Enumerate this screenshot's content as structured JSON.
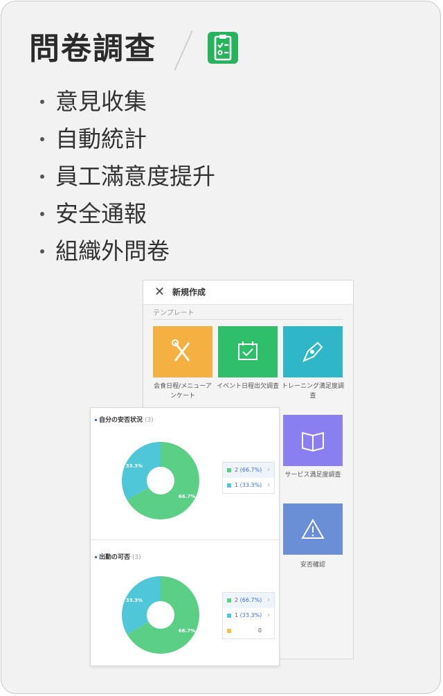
{
  "title": "問卷調查",
  "title_icon": "checklist-icon",
  "accent_color": "#27b35c",
  "features": [
    "意見收集",
    "自動統計",
    "員工滿意度提升",
    "安全通報",
    "組織外問卷"
  ],
  "new_window": {
    "title": "新規作成",
    "subtitle": "テンプレート",
    "templates": [
      {
        "label": "会食日程/メニューアンケート",
        "icon": "fork-knife-icon",
        "color": "#f5b042"
      },
      {
        "label": "イベント日程出欠調査",
        "icon": "calendar-check-icon",
        "color": "#2fbf6a"
      },
      {
        "label": "トレーニング満足度調査",
        "icon": "pen-icon",
        "color": "#2fb7c7"
      },
      {
        "label": "サービス満足度調査",
        "icon": "book-icon",
        "color": "#8a7ff0"
      },
      {
        "label": "安否確認",
        "icon": "warning-icon",
        "color": "#6a8fd6"
      }
    ]
  },
  "stats_window": {
    "panels": [
      {
        "title": "自分の安否状況",
        "count": "(3)",
        "slices": [
          {
            "label": "2",
            "pct_text": "(66.7%)",
            "value": 66.7,
            "color": "#5ccf86",
            "chart_label": "66.7%"
          },
          {
            "label": "1",
            "pct_text": "(33.3%)",
            "value": 33.3,
            "color": "#4fc7d9",
            "chart_label": "33.3%"
          }
        ]
      },
      {
        "title": "出勤の可否",
        "count": "(3)",
        "slices": [
          {
            "label": "2",
            "pct_text": "(66.7%)",
            "value": 66.7,
            "color": "#5ccf86",
            "chart_label": "66.7%"
          },
          {
            "label": "1",
            "pct_text": "(33.3%)",
            "value": 33.3,
            "color": "#4fc7d9",
            "chart_label": "33.3%"
          },
          {
            "label": "",
            "pct_text": "",
            "value": 0,
            "color": "#f5c04a",
            "chart_label": "",
            "count_text": "0"
          }
        ]
      }
    ]
  }
}
